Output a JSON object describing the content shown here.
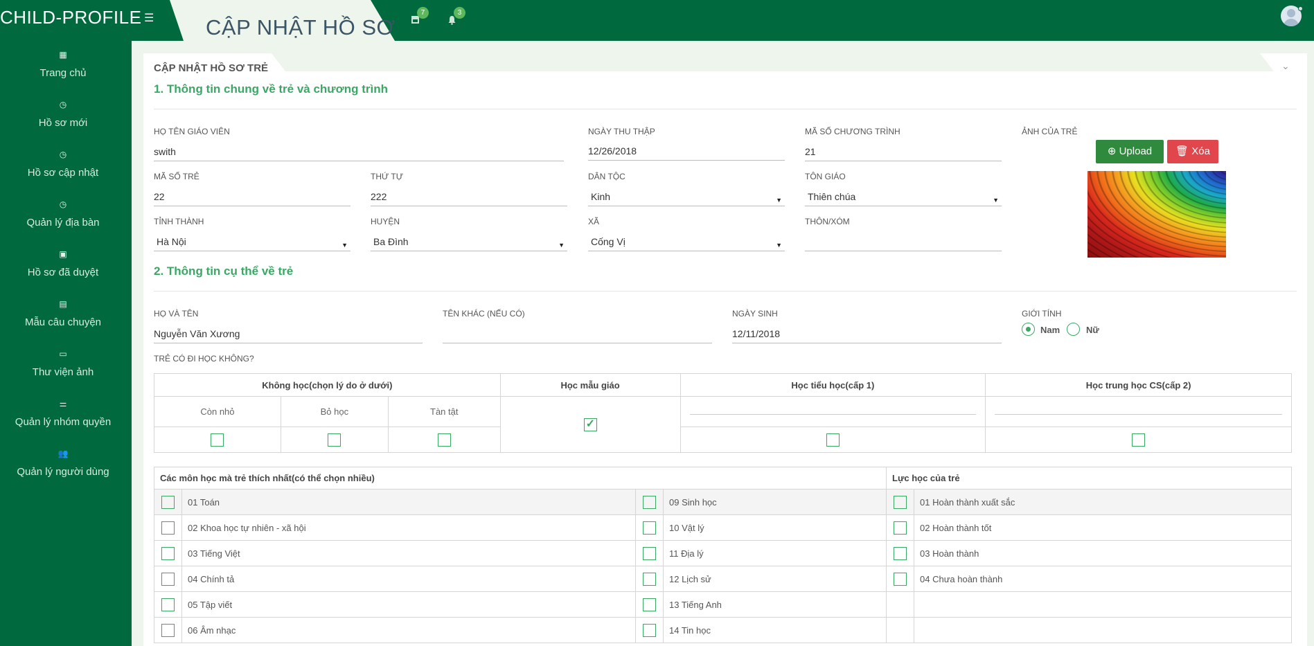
{
  "app": {
    "brand": "CHILD-PROFILE",
    "page_title": "CẬP NHẬT HỒ SƠ"
  },
  "topbar": {
    "icons": [
      {
        "icon": "image-icon",
        "badge": "7"
      },
      {
        "icon": "bell-icon",
        "badge": "3"
      }
    ]
  },
  "sidebar": {
    "items": [
      {
        "icon": "dashboard-icon",
        "label": "Trang chủ"
      },
      {
        "icon": "clock-icon",
        "label": "Hồ sơ mới"
      },
      {
        "icon": "clock-icon",
        "label": "Hồ sơ cập nhật"
      },
      {
        "icon": "clock-icon",
        "label": "Quản lý địa bàn"
      },
      {
        "icon": "save-icon",
        "label": "Hồ sơ đã duyệt"
      },
      {
        "icon": "file-icon",
        "label": "Mẫu câu chuyện"
      },
      {
        "icon": "image-icon",
        "label": "Thư viện ảnh"
      },
      {
        "icon": "sliders-icon",
        "label": "Quản lý nhóm quyền"
      },
      {
        "icon": "users-icon",
        "label": "Quản lý người dùng"
      }
    ]
  },
  "panel": {
    "title": "CẬP NHẬT HỒ SƠ TRẺ",
    "section1": "1. Thông tin chung về trẻ và chương trình",
    "section2": "2. Thông tin cụ thể về trẻ"
  },
  "general": {
    "teacher": {
      "label": "Họ tên giáo viên",
      "value": "swith"
    },
    "date_collected": {
      "label": "Ngày thu thập",
      "value": "12/26/2018"
    },
    "program_code": {
      "label": "Mã số chương trình",
      "value": "21"
    },
    "photo_label": "Ảnh của trẻ",
    "upload_label": "Upload",
    "delete_label": "Xóa",
    "child_code": {
      "label": "Mã số trẻ",
      "value": "22"
    },
    "order": {
      "label": "Thứ tự",
      "value": "222"
    },
    "ethnicity": {
      "label": "Dân tộc",
      "value": "Kinh"
    },
    "religion": {
      "label": "Tôn giáo",
      "value": "Thiên chúa"
    },
    "province": {
      "label": "Tỉnh thành",
      "value": "Hà Nội"
    },
    "district": {
      "label": "Huyện",
      "value": "Ba Đình"
    },
    "commune": {
      "label": "Xã",
      "value": "Cống Vị"
    },
    "village": {
      "label": "Thôn/Xóm",
      "value": ""
    }
  },
  "detail": {
    "full_name": {
      "label": "Họ và tên",
      "value": "Nguyễn Văn Xương"
    },
    "other_name": {
      "label": "Tên khác (nếu có)",
      "value": ""
    },
    "birth_date": {
      "label": "Ngày sinh",
      "value": "12/11/2018"
    },
    "gender": {
      "label": "Giới tính",
      "options": [
        "Nam",
        "Nữ"
      ],
      "selected": "Nam"
    },
    "school_question": "Trẻ có đi học không?"
  },
  "education": {
    "headers": [
      "Không học(chọn lý do ở dưới)",
      "Học mẫu giáo",
      "Học tiểu học(cấp 1)",
      "Học trung học CS(cấp 2)"
    ],
    "reasons": [
      "Còn nhỏ",
      "Bỏ học",
      "Tàn tật"
    ],
    "kindergarten_checked": true
  },
  "subjects": {
    "header": "Các môn học mà trẻ thích nhất(có thể chọn nhiều)",
    "col1": [
      "01 Toán",
      "02 Khoa học tự nhiên - xã hội",
      "03 Tiếng Việt",
      "04 Chính tả",
      "05 Tập viết",
      "06 Âm nhạc"
    ],
    "col2": [
      "09 Sinh học",
      "10 Vật lý",
      "11 Địa lý",
      "12 Lịch sử",
      "13 Tiếng Anh",
      "14 Tin học"
    ]
  },
  "performance": {
    "header": "Lực học của trẻ",
    "items": [
      "01 Hoàn thành xuất sắc",
      "02 Hoàn thành tốt",
      "03 Hoàn thành",
      "04 Chưa hoàn thành"
    ]
  },
  "colors": {
    "primary": "#00693e",
    "accent": "#3aa864",
    "upload": "#2f8a3d",
    "delete": "#e0464b"
  }
}
